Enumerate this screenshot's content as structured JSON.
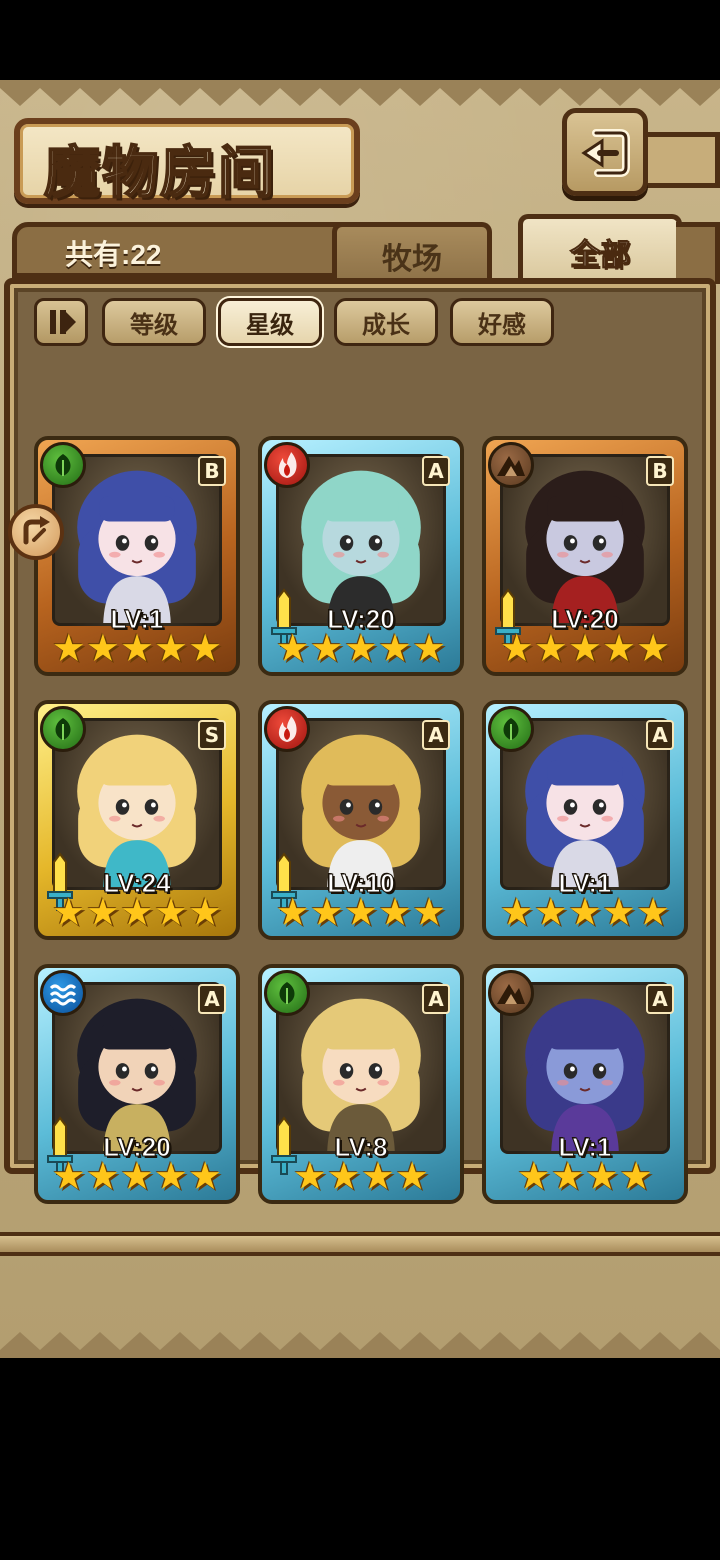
{
  "header": {
    "title": "魔物房间",
    "back_icon": "back-arrow-icon"
  },
  "summary": {
    "count_label": "共有:22"
  },
  "tabs": [
    {
      "label": "牧场",
      "active": false
    },
    {
      "label": "全部",
      "active": true
    }
  ],
  "sort": {
    "toggle_icon": "sort-order-icon",
    "options": [
      {
        "label": "等级",
        "active": false
      },
      {
        "label": "星级",
        "active": true
      },
      {
        "label": "成长",
        "active": false
      },
      {
        "label": "好感",
        "active": false
      }
    ]
  },
  "monsters": [
    {
      "element": "grass",
      "grade": "B",
      "frame": "bronze",
      "level": "LV:1",
      "stars": 5,
      "weapon": false,
      "portrait": "blue-hair-knight"
    },
    {
      "element": "fire",
      "grade": "A",
      "frame": "blue",
      "level": "LV:20",
      "stars": 5,
      "weapon": true,
      "portrait": "pirate-girl"
    },
    {
      "element": "earth",
      "grade": "B",
      "frame": "bronze",
      "level": "LV:20",
      "stars": 5,
      "weapon": true,
      "portrait": "vampire-girl"
    },
    {
      "element": "grass",
      "grade": "S",
      "frame": "gold",
      "level": "LV:24",
      "stars": 5,
      "weapon": true,
      "portrait": "mermaid-princess"
    },
    {
      "element": "fire",
      "grade": "A",
      "frame": "blue",
      "level": "LV:10",
      "stars": 5,
      "weapon": true,
      "portrait": "tan-horned-girl"
    },
    {
      "element": "grass",
      "grade": "A",
      "frame": "blue",
      "level": "LV:1",
      "stars": 5,
      "weapon": false,
      "portrait": "blue-hair-knight"
    },
    {
      "element": "water",
      "grade": "A",
      "frame": "blue",
      "level": "LV:20",
      "stars": 5,
      "weapon": true,
      "portrait": "dragon-boy"
    },
    {
      "element": "grass",
      "grade": "A",
      "frame": "blue",
      "level": "LV:8",
      "stars": 4,
      "weapon": true,
      "portrait": "blonde-staff-girl"
    },
    {
      "element": "earth",
      "grade": "A",
      "frame": "blue",
      "level": "LV:1",
      "stars": 4,
      "weapon": false,
      "portrait": "galaxy-slime-girl"
    }
  ],
  "colors": {
    "frame_bronze": "#b8641f",
    "frame_blue": "#5cbcd8",
    "frame_gold": "#e5b72a",
    "star": "#ffc61a",
    "panel": "#7a6444"
  }
}
